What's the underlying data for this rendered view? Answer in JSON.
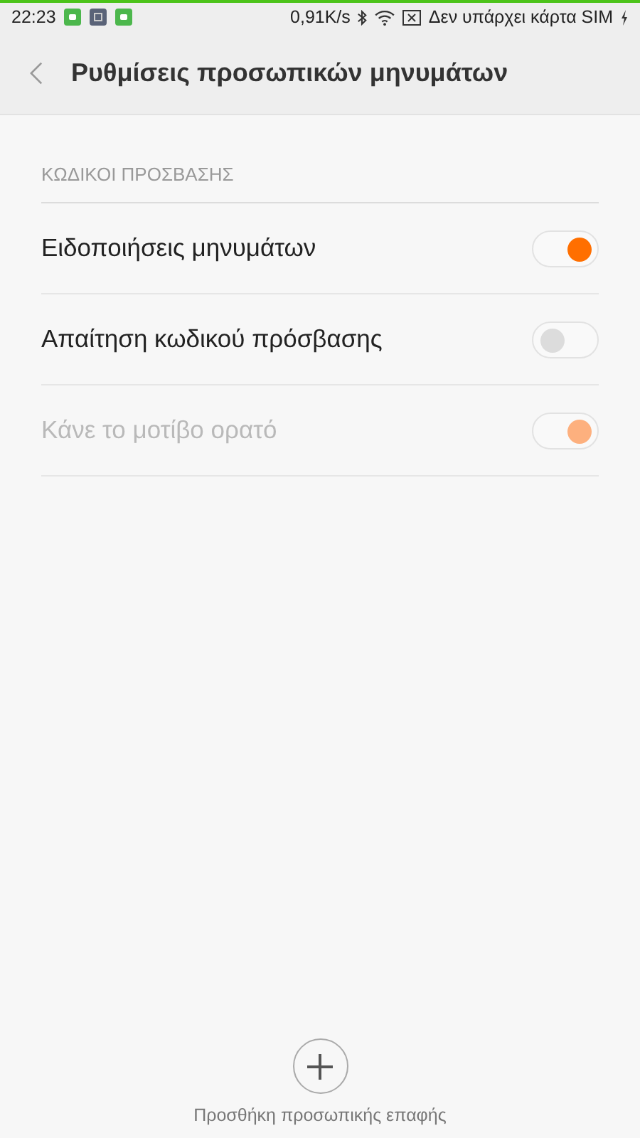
{
  "status_bar": {
    "time": "22:23",
    "speed": "0,91K/s",
    "carrier": "Δεν υπάρχει κάρτα SIM"
  },
  "header": {
    "title": "Ρυθμίσεις προσωπικών μηνυμάτων"
  },
  "section": {
    "title": "ΚΩΔΙΚΟΙ ΠΡΟΣΒΑΣΗΣ"
  },
  "settings": [
    {
      "label": "Ειδοποιήσεις μηνυμάτων",
      "on": true,
      "disabled": false
    },
    {
      "label": "Απαίτηση κωδικού πρόσβασης",
      "on": false,
      "disabled": false
    },
    {
      "label": "Κάνε το μοτίβο ορατό",
      "on": true,
      "disabled": true
    }
  ],
  "add_button": {
    "label": "Προσθήκη προσωπικής επαφής"
  }
}
